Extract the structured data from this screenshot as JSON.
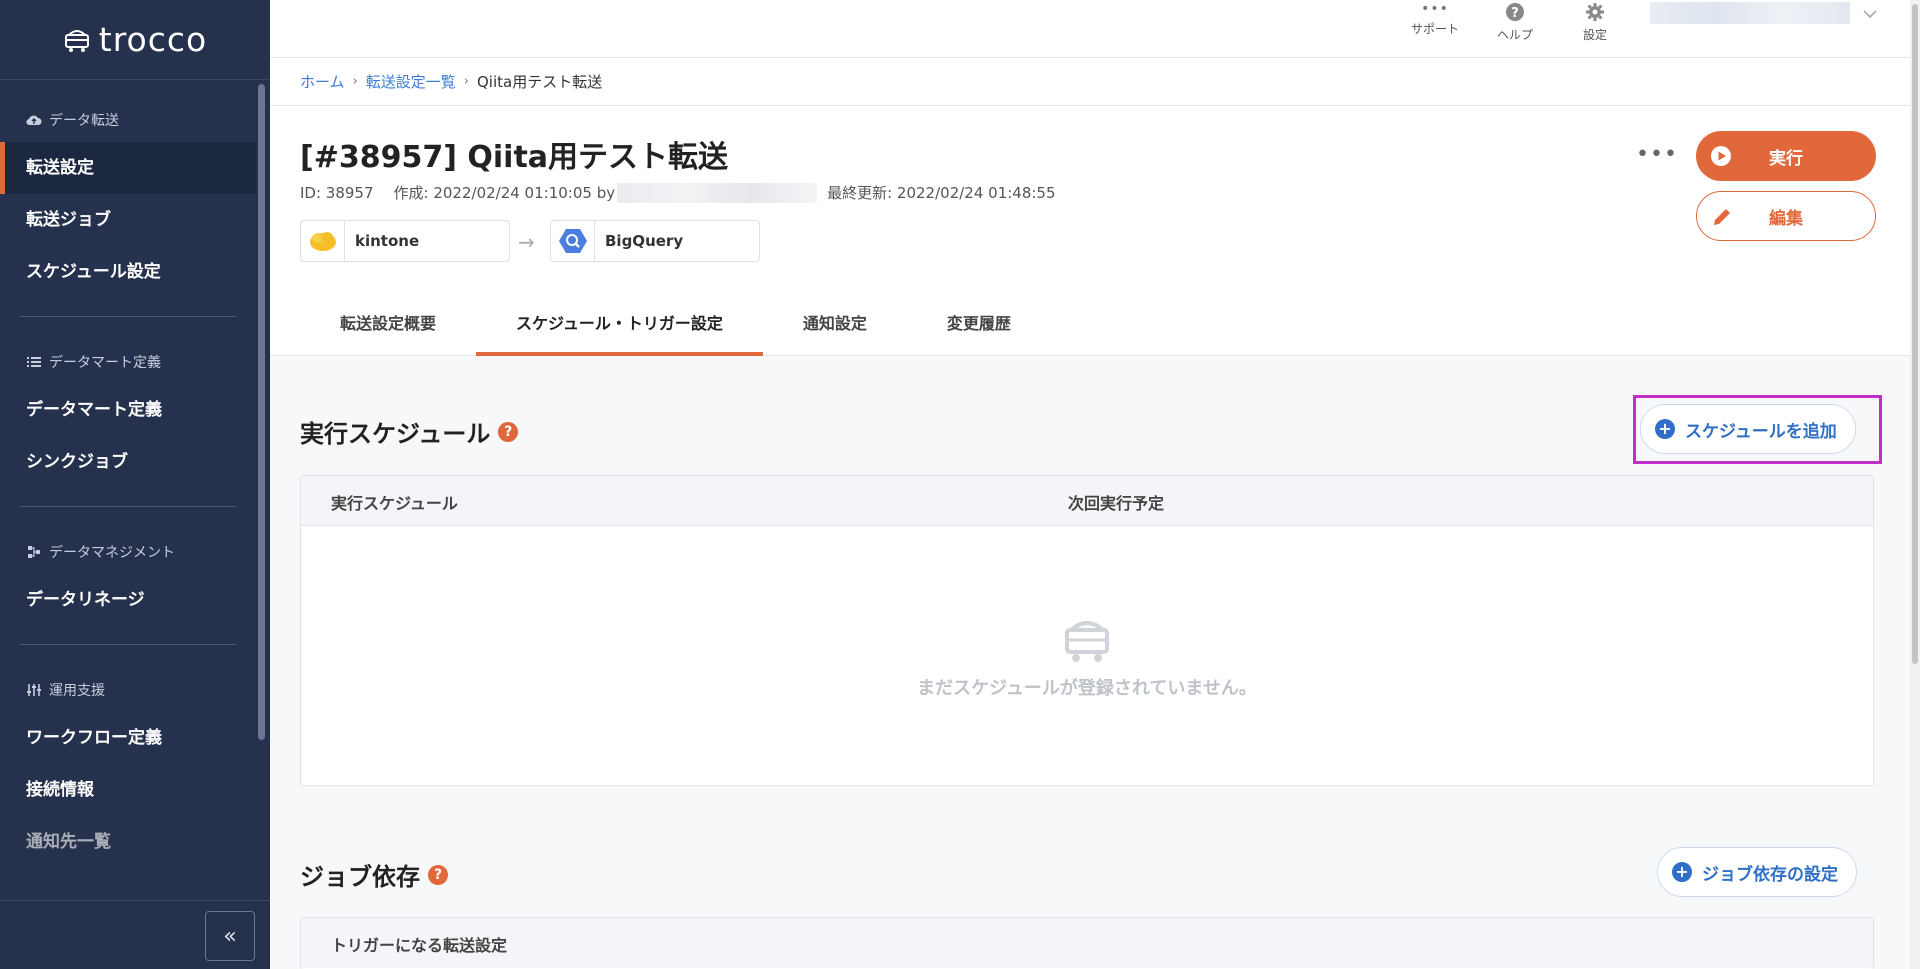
{
  "app": {
    "logo_text": "trocco"
  },
  "sidebar": {
    "sections": [
      {
        "title": "データ転送",
        "icon": "cloud-upload-icon",
        "items": [
          "転送設定",
          "転送ジョブ",
          "スケジュール設定"
        ]
      },
      {
        "title": "データマート定義",
        "icon": "list-icon",
        "items": [
          "データマート定義",
          "シンクジョブ"
        ]
      },
      {
        "title": "データマネジメント",
        "icon": "lineage-icon",
        "items": [
          "データリネージ"
        ]
      },
      {
        "title": "運用支援",
        "icon": "sliders-icon",
        "items": [
          "ワークフロー定義",
          "接続情報",
          "通知先一覧"
        ]
      }
    ],
    "active_item": "転送設定",
    "collapse_label": "«"
  },
  "topbar": {
    "support_label": "サポート",
    "help_label": "ヘルプ",
    "settings_label": "設定"
  },
  "breadcrumb": {
    "home": "ホーム",
    "list": "転送設定一覧",
    "current": "Qiita用テスト転送"
  },
  "header": {
    "title": "[#38957] Qiita用テスト転送",
    "id_text": "ID: 38957",
    "created_text": "作成: 2022/02/24 01:10:05 by",
    "updated_text": "最終更新: 2022/02/24 01:48:55",
    "source_name": "kintone",
    "dest_name": "BigQuery",
    "run_label": "実行",
    "edit_label": "編集",
    "more_label": "•••"
  },
  "tabs": [
    {
      "label": "転送設定概要",
      "active": false
    },
    {
      "label": "スケジュール・トリガー設定",
      "active": true
    },
    {
      "label": "通知設定",
      "active": false
    },
    {
      "label": "変更履歴",
      "active": false
    }
  ],
  "schedule": {
    "title": "実行スケジュール",
    "add_label": "スケジュールを追加",
    "col_schedule": "実行スケジュール",
    "col_next": "次回実行予定",
    "empty_text": "まだスケジュールが登録されていません。"
  },
  "dependency": {
    "title": "ジョブ依存",
    "set_label": "ジョブ依存の設定",
    "col_trigger": "トリガーになる転送設定"
  },
  "colors": {
    "sidebar_bg": "#26324d",
    "accent": "#e0683a",
    "link": "#3b7dd8",
    "highlight": "#c22ec9"
  }
}
